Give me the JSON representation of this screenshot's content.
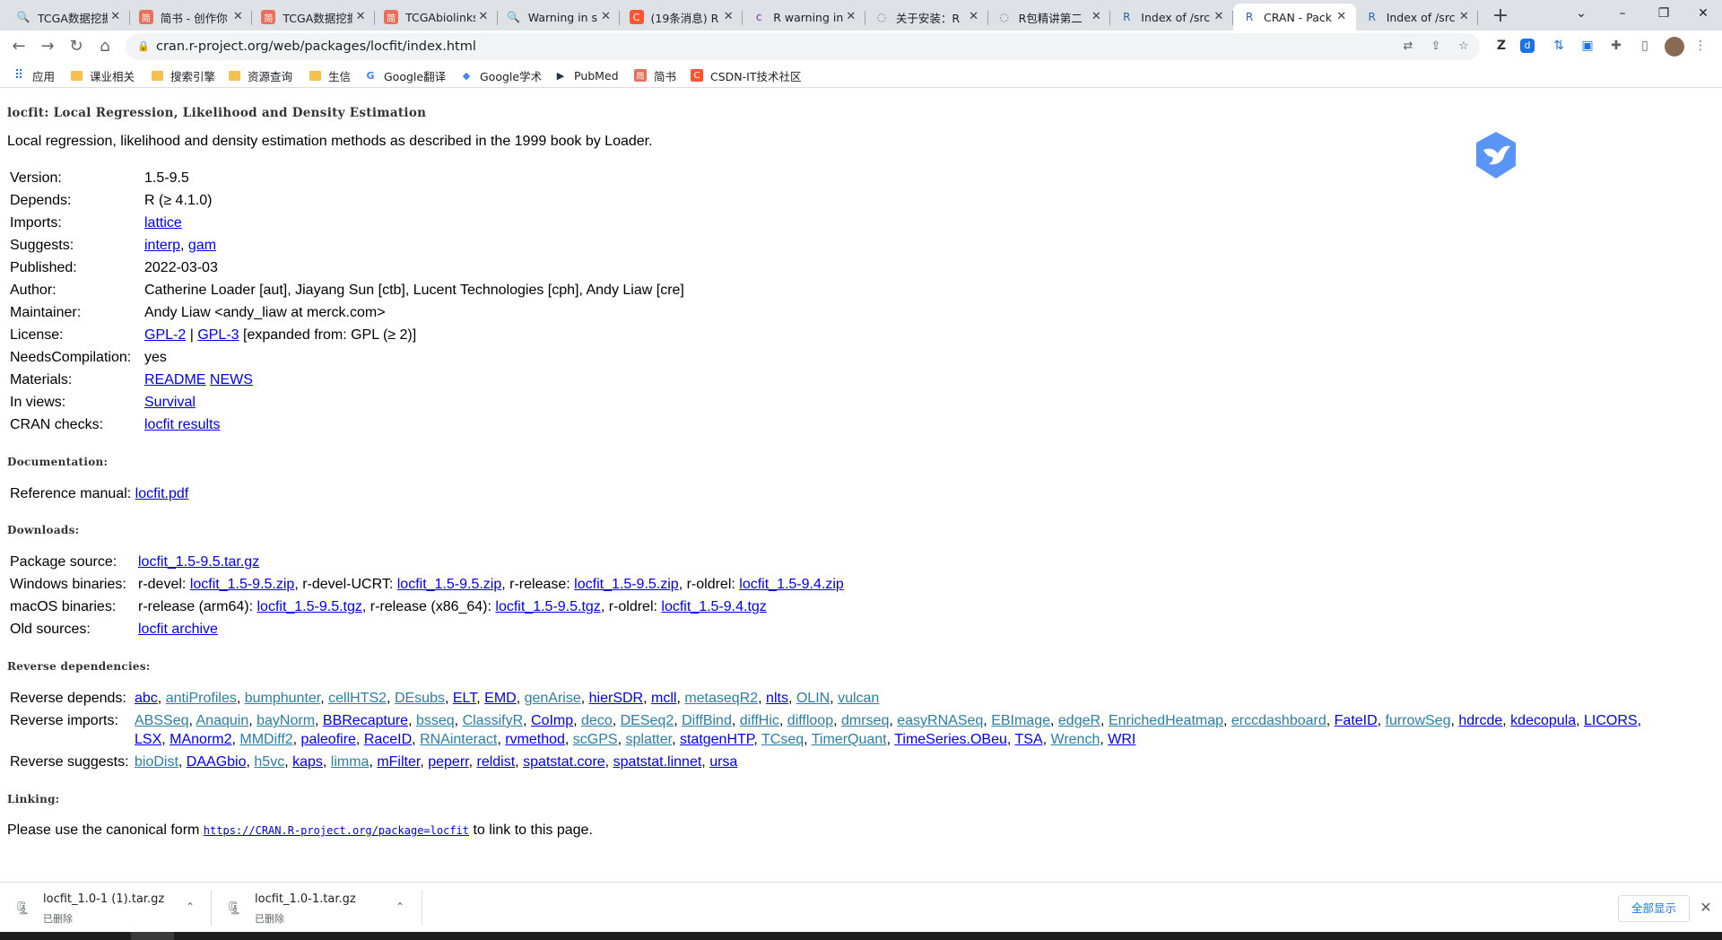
{
  "browser": {
    "tabs": [
      {
        "title": "TCGA数据挖掘",
        "icon": "search-icon"
      },
      {
        "title": "简书 - 创作你",
        "icon": "jianshu-icon"
      },
      {
        "title": "TCGA数据挖掘",
        "icon": "jianshu-icon"
      },
      {
        "title": "TCGAbiolinks",
        "icon": "jianshu-icon"
      },
      {
        "title": "Warning in s",
        "icon": "search-icon"
      },
      {
        "title": "(19条消息) R",
        "icon": "csdn-icon"
      },
      {
        "title": "R warning in",
        "icon": "cnblogs-icon"
      },
      {
        "title": "关于安装：R",
        "icon": "globe-icon"
      },
      {
        "title": "R包精讲第二",
        "icon": "globe-icon"
      },
      {
        "title": "Index of /src",
        "icon": "r-icon"
      },
      {
        "title": "CRAN - Pack",
        "icon": "r-icon",
        "active": true
      },
      {
        "title": "Index of /src",
        "icon": "r-icon"
      }
    ],
    "url": "cran.r-project.org/web/packages/locfit/index.html",
    "bookmarks": [
      {
        "label": "应用",
        "icon": "apps-grid-icon"
      },
      {
        "label": "课业相关",
        "icon": "folder-icon"
      },
      {
        "label": "搜索引擎",
        "icon": "folder-icon"
      },
      {
        "label": "资源查询",
        "icon": "folder-icon"
      },
      {
        "label": "生信",
        "icon": "folder-icon"
      },
      {
        "label": "Google翻译",
        "icon": "google-translate-icon"
      },
      {
        "label": "Google学术",
        "icon": "google-scholar-icon"
      },
      {
        "label": "PubMed",
        "icon": "pubmed-icon"
      },
      {
        "label": "简书",
        "icon": "jianshu-icon"
      },
      {
        "label": "CSDN-IT技术社区",
        "icon": "csdn-icon"
      }
    ]
  },
  "page": {
    "title": "locfit: Local Regression, Likelihood and Density Estimation",
    "description": "Local regression, likelihood and density estimation methods as described in the 1999 book by Loader.",
    "fields": {
      "version_label": "Version:",
      "version": "1.5-9.5",
      "depends_label": "Depends:",
      "depends": "R (≥ 4.1.0)",
      "imports_label": "Imports:",
      "imports": "lattice",
      "suggests_label": "Suggests:",
      "suggests_1": "interp",
      "suggests_2": "gam",
      "published_label": "Published:",
      "published": "2022-03-03",
      "author_label": "Author:",
      "author": "Catherine Loader [aut], Jiayang Sun [ctb], Lucent Technologies [cph], Andy Liaw [cre]",
      "maintainer_label": "Maintainer:",
      "maintainer": "Andy Liaw <andy_liaw at merck.com>",
      "license_label": "License:",
      "license_1": "GPL-2",
      "license_sep": "|",
      "license_2": "GPL-3",
      "license_rest": "[expanded from: GPL (≥ 2)]",
      "needs_label": "NeedsCompilation:",
      "needs": "yes",
      "materials_label": "Materials:",
      "materials_1": "README",
      "materials_2": "NEWS",
      "views_label": "In views:",
      "views": "Survival",
      "checks_label": "CRAN checks:",
      "checks": "locfit results"
    },
    "documentation": {
      "heading": "Documentation:",
      "label": "Reference manual:",
      "link": "locfit.pdf"
    },
    "downloads": {
      "heading": "Downloads:",
      "source_label": "Package source:",
      "source": "locfit_1.5-9.5.tar.gz",
      "win_label": "Windows binaries:",
      "win_1_pre": "r-devel:",
      "win_1": "locfit_1.5-9.5.zip",
      "win_2_pre": ", r-devel-UCRT:",
      "win_2": "locfit_1.5-9.5.zip",
      "win_3_pre": ", r-release:",
      "win_3": "locfit_1.5-9.5.zip",
      "win_4_pre": ", r-oldrel:",
      "win_4": "locfit_1.5-9.4.zip",
      "mac_label": "macOS binaries:",
      "mac_1_pre": "r-release (arm64):",
      "mac_1": "locfit_1.5-9.5.tgz",
      "mac_2_pre": ", r-release (x86_64):",
      "mac_2": "locfit_1.5-9.5.tgz",
      "mac_3_pre": ", r-oldrel:",
      "mac_3": "locfit_1.5-9.4.tgz",
      "old_label": "Old sources:",
      "old": "locfit archive"
    },
    "reverse": {
      "heading": "Reverse dependencies:",
      "depends_label": "Reverse depends:",
      "depends": [
        {
          "t": "abc",
          "bio": false
        },
        {
          "t": "antiProfiles",
          "bio": true
        },
        {
          "t": "bumphunter",
          "bio": true
        },
        {
          "t": "cellHTS2",
          "bio": true
        },
        {
          "t": "DEsubs",
          "bio": true
        },
        {
          "t": "ELT",
          "bio": false
        },
        {
          "t": "EMD",
          "bio": false
        },
        {
          "t": "genArise",
          "bio": true
        },
        {
          "t": "hierSDR",
          "bio": false
        },
        {
          "t": "mcll",
          "bio": false
        },
        {
          "t": "metaseqR2",
          "bio": true
        },
        {
          "t": "nlts",
          "bio": false
        },
        {
          "t": "OLIN",
          "bio": true
        },
        {
          "t": "vulcan",
          "bio": true
        }
      ],
      "imports_label": "Reverse imports:",
      "imports_line1": [
        {
          "t": "ABSSeq",
          "bio": true
        },
        {
          "t": "Anaquin",
          "bio": true
        },
        {
          "t": "bayNorm",
          "bio": true
        },
        {
          "t": "BBRecapture",
          "bio": false
        },
        {
          "t": "bsseq",
          "bio": true
        },
        {
          "t": "ClassifyR",
          "bio": true
        },
        {
          "t": "CoImp",
          "bio": false
        },
        {
          "t": "deco",
          "bio": true
        },
        {
          "t": "DESeq2",
          "bio": true
        },
        {
          "t": "DiffBind",
          "bio": true
        },
        {
          "t": "diffHic",
          "bio": true
        },
        {
          "t": "diffloop",
          "bio": true
        },
        {
          "t": "dmrseq",
          "bio": true
        },
        {
          "t": "easyRNASeq",
          "bio": true
        },
        {
          "t": "EBImage",
          "bio": true
        },
        {
          "t": "edgeR",
          "bio": true
        },
        {
          "t": "EnrichedHeatmap",
          "bio": true
        },
        {
          "t": "erccdashboard",
          "bio": true
        },
        {
          "t": "FateID",
          "bio": false
        },
        {
          "t": "furrowSeg",
          "bio": true
        },
        {
          "t": "hdrcde",
          "bio": false
        },
        {
          "t": "kdecopula",
          "bio": false
        },
        {
          "t": "LICORS",
          "bio": false
        }
      ],
      "imports_line2": [
        {
          "t": "LSX",
          "bio": false
        },
        {
          "t": "MAnorm2",
          "bio": false
        },
        {
          "t": "MMDiff2",
          "bio": true
        },
        {
          "t": "paleofire",
          "bio": false
        },
        {
          "t": "RaceID",
          "bio": false
        },
        {
          "t": "RNAinteract",
          "bio": true
        },
        {
          "t": "rvmethod",
          "bio": false
        },
        {
          "t": "scGPS",
          "bio": true
        },
        {
          "t": "splatter",
          "bio": true
        },
        {
          "t": "statgenHTP",
          "bio": false
        },
        {
          "t": "TCseq",
          "bio": true
        },
        {
          "t": "TimerQuant",
          "bio": true
        },
        {
          "t": "TimeSeries.OBeu",
          "bio": false
        },
        {
          "t": "TSA",
          "bio": false
        },
        {
          "t": "Wrench",
          "bio": true
        },
        {
          "t": "WRI",
          "bio": false
        }
      ],
      "suggests_label": "Reverse suggests:",
      "suggests": [
        {
          "t": "bioDist",
          "bio": true
        },
        {
          "t": "DAAGbio",
          "bio": false
        },
        {
          "t": "h5vc",
          "bio": true
        },
        {
          "t": "kaps",
          "bio": false
        },
        {
          "t": "limma",
          "bio": true
        },
        {
          "t": "mFilter",
          "bio": false
        },
        {
          "t": "peperr",
          "bio": false
        },
        {
          "t": "reldist",
          "bio": false
        },
        {
          "t": "spatstat.core",
          "bio": false
        },
        {
          "t": "spatstat.linnet",
          "bio": false
        },
        {
          "t": "ursa",
          "bio": false
        }
      ]
    },
    "linking": {
      "heading": "Linking:",
      "pre": "Please use the canonical form",
      "url": "https://CRAN.R-project.org/package=locfit",
      "post": "to link to this page."
    }
  },
  "downloads_bar": {
    "items": [
      {
        "name": "locfit_1.0-1 (1).tar.gz",
        "status": "已删除"
      },
      {
        "name": "locfit_1.0-1.tar.gz",
        "status": "已删除"
      }
    ],
    "show_all": "全部显示"
  },
  "colors": {
    "link": "#0000ee",
    "view_link": "#2a7fa4",
    "tabstrip": "#dee1e6"
  }
}
